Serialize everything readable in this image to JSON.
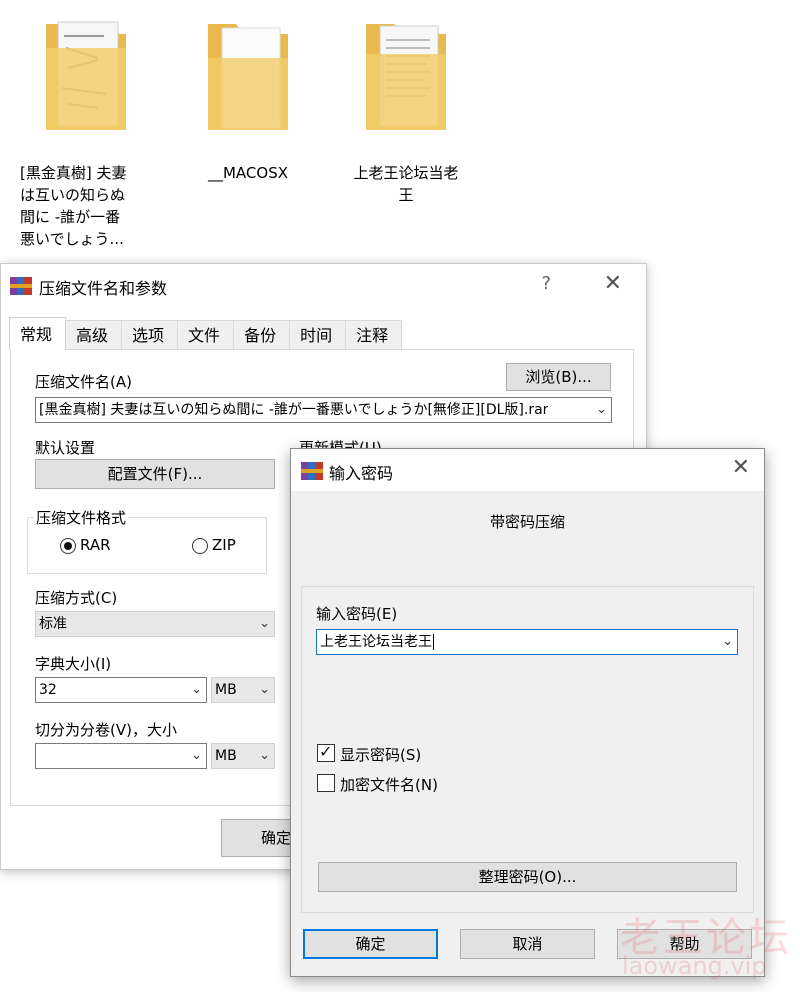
{
  "desktop": {
    "items": [
      {
        "label": "[黒金真樹] 夫妻\nは互いの知らぬ\n間に -誰が一番\n悪いでしょう..."
      },
      {
        "label": "__MACOSX"
      },
      {
        "label": "上老王论坛当老\n王"
      }
    ]
  },
  "main_dialog": {
    "title": "压缩文件名和参数",
    "help": "?",
    "close": "✕",
    "tabs": [
      "常规",
      "高级",
      "选项",
      "文件",
      "备份",
      "时间",
      "注释"
    ],
    "archive_name_label": "压缩文件名(A)",
    "browse_button": "浏览(B)...",
    "archive_name_value": "[黒金真樹] 夫妻は互いの知らぬ間に -誰が一番悪いでしょうか[無修正][DL版].rar",
    "default_settings_label": "默认设置",
    "profiles_button": "配置文件(F)...",
    "update_mode_label": "更新模式(U)",
    "format_group_label": "压缩文件格式",
    "format_rar": "RAR",
    "format_zip": "ZIP",
    "selected_format": "RAR",
    "method_label": "压缩方式(C)",
    "method_value": "标准",
    "dict_label": "字典大小(I)",
    "dict_value": "32",
    "dict_unit": "MB",
    "split_label": "切分为分卷(V)，大小",
    "split_value": "",
    "split_unit": "MB",
    "ok_button_partial": "确定"
  },
  "password_dialog": {
    "title": "输入密码",
    "close": "✕",
    "heading": "带密码压缩",
    "password_label": "输入密码(E)",
    "password_value": "上老王论坛当老王",
    "show_password_label": "显示密码(S)",
    "show_password_checked": true,
    "encrypt_names_label": "加密文件名(N)",
    "encrypt_names_checked": false,
    "organize_button": "整理密码(O)...",
    "ok_button": "确定",
    "cancel_button": "取消",
    "help_button": "帮助"
  },
  "watermark": {
    "line1": "老王论坛",
    "line2": "laowang.vip"
  }
}
